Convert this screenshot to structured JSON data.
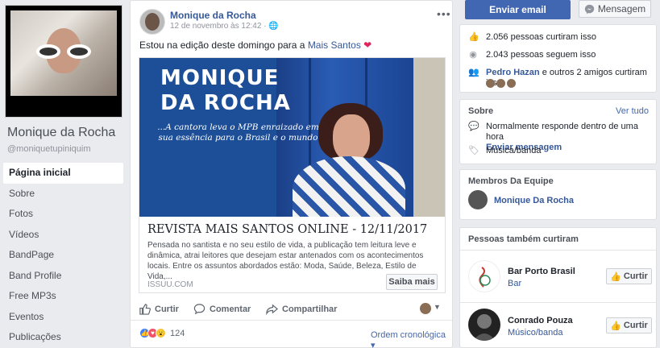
{
  "profile": {
    "name": "Monique da Rocha",
    "handle": "@moniquetupiniquim"
  },
  "nav": {
    "items": [
      {
        "label": "Página inicial",
        "active": true
      },
      {
        "label": "Sobre"
      },
      {
        "label": "Fotos"
      },
      {
        "label": "Vídeos"
      },
      {
        "label": "BandPage"
      },
      {
        "label": "Band Profile"
      },
      {
        "label": "Free MP3s"
      },
      {
        "label": "Eventos"
      },
      {
        "label": "Publicações"
      }
    ]
  },
  "post": {
    "author": "Monique da Rocha",
    "time": "12 de novembro às 12:42 · ",
    "menu": "•••",
    "text_prefix": "Estou na edição deste domingo para a ",
    "text_link": "Mais Santos",
    "text_emoji": " ❤",
    "link_card": {
      "image_title_line1": "MONIQUE",
      "image_title_line2": "DA ROCHA",
      "image_subtitle": "...A cantora leva o MPB enraizado em sua essência para o Brasil e o mundo",
      "title": "REVISTA MAIS SANTOS ONLINE - 12/11/2017",
      "description": "Pensada no santista e no seu estilo de vida, a publicação tem leitura leve e dinâmica, atrai leitores que desejam estar antenados com os acontecimentos locais. Entre os assuntos abordados estão: Moda, Saúde, Beleza, Estilo de Vida,...",
      "domain": "ISSUU.COM",
      "cta": "Saiba mais"
    },
    "actions": {
      "like": "Curtir",
      "comment": "Comentar",
      "share": "Compartilhar"
    },
    "reactions_count": "124",
    "order": "Ordem cronológica ▾"
  },
  "sidebar": {
    "email_button": "Enviar email",
    "message_button": "Mensagem",
    "stats": {
      "likes": "2.056 pessoas curtiram isso",
      "follows": "2.043 pessoas seguem isso",
      "friend_name": "Pedro Hazan",
      "friend_suffix": " e outros 2 amigos curtiram isso"
    },
    "about": {
      "header": "Sobre",
      "see_all": "Ver tudo",
      "response": "Normalmente responde dentro de uma hora",
      "send_message": "Enviar mensagem",
      "category": "Música/banda"
    },
    "team": {
      "header": "Membros Da Equipe",
      "member": "Monique Da Rocha"
    },
    "also_liked": {
      "header": "Pessoas também curtiram",
      "pages": [
        {
          "name": "Bar Porto Brasil",
          "category": "Bar",
          "button": "Curtir"
        },
        {
          "name": "Conrado Pouza",
          "category": "Músico/banda",
          "button": "Curtir"
        }
      ]
    }
  },
  "colors": {
    "brand_blue": "#4267b2",
    "link_blue": "#365899",
    "background": "#e9ebee"
  }
}
